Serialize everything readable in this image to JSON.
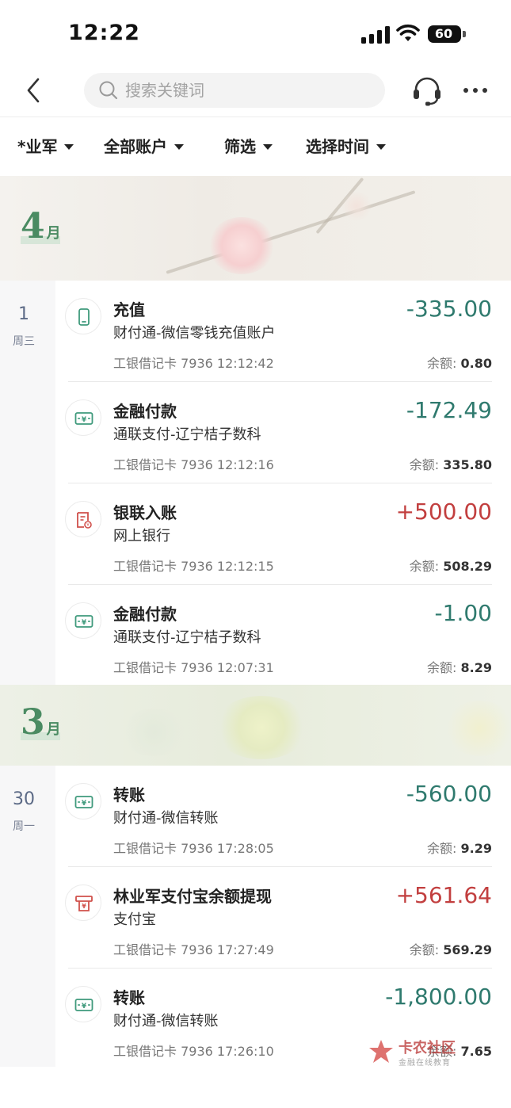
{
  "status_bar": {
    "time": "12:22",
    "battery": "60"
  },
  "nav": {
    "search_placeholder": "搜索关键词"
  },
  "filters": [
    {
      "label": "*业军"
    },
    {
      "label": "全部账户"
    },
    {
      "label": "筛选"
    },
    {
      "label": "选择时间"
    }
  ],
  "months": [
    {
      "num": "4",
      "unit": "月"
    },
    {
      "num": "3",
      "unit": "月"
    }
  ],
  "days": [
    {
      "day": "1",
      "weekday": "周三"
    },
    {
      "day": "30",
      "weekday": "周一"
    }
  ],
  "balance_label": "余额:",
  "transactions": [
    {
      "icon": "phone-icon",
      "title": "充值",
      "subtitle": "财付通-微信零钱充值账户",
      "card": "工银借记卡 7936 12:12:42",
      "amount": "-335.00",
      "balance": "0.80",
      "direction": "out"
    },
    {
      "icon": "money-transfer-icon",
      "title": "金融付款",
      "subtitle": "通联支付-辽宁桔子数科",
      "card": "工银借记卡 7936 12:12:16",
      "amount": "-172.49",
      "balance": "335.80",
      "direction": "out"
    },
    {
      "icon": "bill-icon",
      "title": "银联入账",
      "subtitle": "网上银行",
      "card": "工银借记卡 7936 12:12:15",
      "amount": "+500.00",
      "balance": "508.29",
      "direction": "in"
    },
    {
      "icon": "money-transfer-icon",
      "title": "金融付款",
      "subtitle": "通联支付-辽宁桔子数科",
      "card": "工银借记卡 7936 12:07:31",
      "amount": "-1.00",
      "balance": "8.29",
      "direction": "out"
    },
    {
      "icon": "money-transfer-icon",
      "title": "转账",
      "subtitle": "财付通-微信转账",
      "card": "工银借记卡 7936 17:28:05",
      "amount": "-560.00",
      "balance": "9.29",
      "direction": "out"
    },
    {
      "icon": "withdraw-icon",
      "title": "林业军支付宝余额提现",
      "subtitle": "支付宝",
      "card": "工银借记卡 7936 17:27:49",
      "amount": "+561.64",
      "balance": "569.29",
      "direction": "in"
    },
    {
      "icon": "money-transfer-icon",
      "title": "转账",
      "subtitle": "财付通-微信转账",
      "card": "工银借记卡 7936 17:26:10",
      "amount": "-1,800.00",
      "balance": "7.65",
      "direction": "out"
    }
  ],
  "watermark": {
    "title": "卡农社区",
    "subtitle": "金融在线教育"
  },
  "colors": {
    "outflow": "#2f7a6e",
    "inflow": "#c23f3f",
    "month_green": "#4a8b62",
    "day_text": "#5c6a86"
  }
}
